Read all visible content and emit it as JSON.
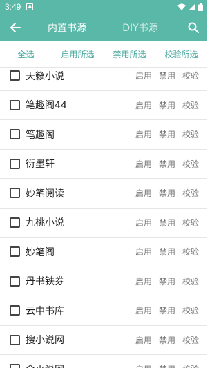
{
  "status": {
    "time": "3:49",
    "notif_icon": "A"
  },
  "appbar": {
    "tabs": [
      "内置书源",
      "DIY书源"
    ]
  },
  "actions": [
    "全选",
    "启用所选",
    "禁用所选",
    "校验所选"
  ],
  "rows": [
    "天籁小说",
    "笔趣阁44",
    "笔趣阁",
    "衍墨轩",
    "妙笔阅读",
    "九桃小说",
    "妙笔阁",
    "丹书铁券",
    "云中书库",
    "搜小说网",
    "全小说网"
  ],
  "row_buttons": {
    "enable": "启用",
    "disable": "禁用",
    "verify": "校验"
  },
  "colors": {
    "accent": "#5ab8a8",
    "accent_text": "#4aa9a0"
  }
}
